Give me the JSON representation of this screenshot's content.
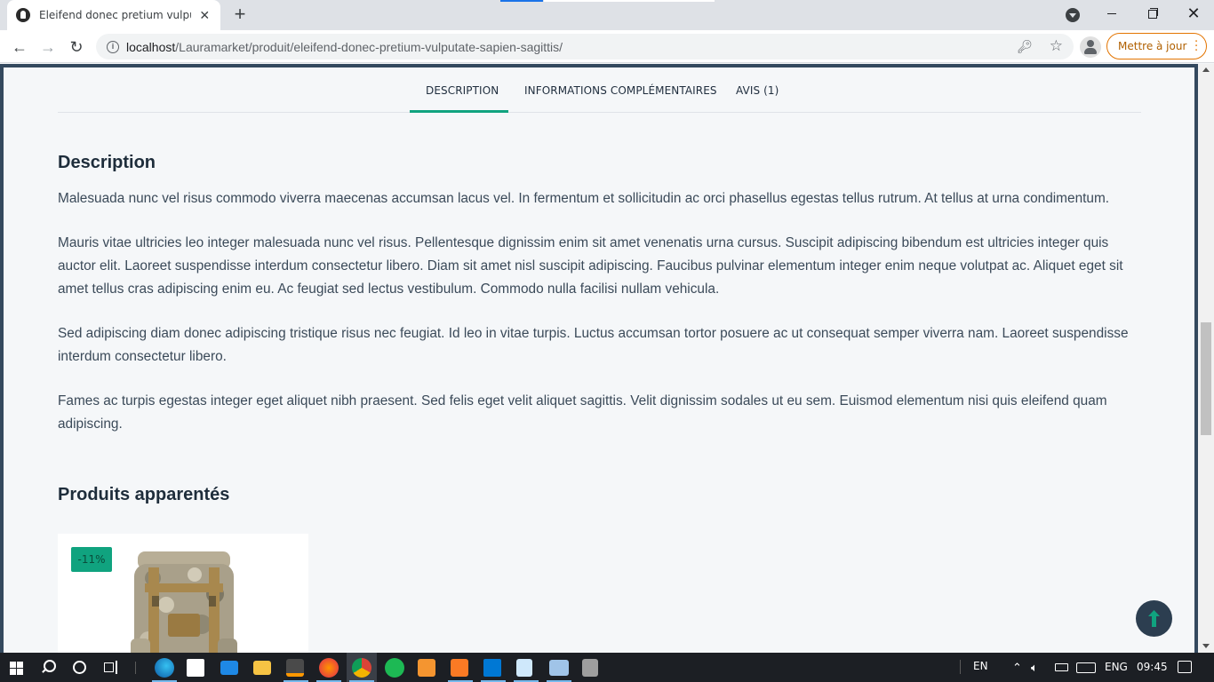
{
  "browser": {
    "tab_title": "Eleifend donec pretium vulputate sapien sagittis – Lauramarket",
    "new_tab_label": "+",
    "close_tab_label": "✕",
    "url_host": "localhost",
    "url_path": "/Lauramarket/produit/eleifend-donec-pretium-vulputate-sapien-sagittis/",
    "update_button_label": "Mettre à jour",
    "window_close_label": "✕"
  },
  "page": {
    "tabs": [
      {
        "label": "DESCRIPTION",
        "active": true
      },
      {
        "label": "INFORMATIONS COMPLÉMENTAIRES",
        "active": false
      },
      {
        "label": "AVIS (1)",
        "active": false
      }
    ],
    "description_heading": "Description",
    "paragraphs": [
      "Malesuada nunc vel risus commodo viverra maecenas accumsan lacus vel. In fermentum et sollicitudin ac orci phasellus egestas tellus rutrum. At tellus at urna condimentum.",
      "Mauris vitae ultricies leo integer malesuada nunc vel risus. Pellentesque dignissim enim sit amet venenatis urna cursus. Suscipit adipiscing bibendum est ultricies integer quis auctor elit. Laoreet suspendisse interdum consectetur libero. Diam sit amet nisl suscipit adipiscing. Faucibus pulvinar elementum integer enim neque volutpat ac. Aliquet eget sit amet tellus cras adipiscing enim eu. Ac feugiat sed lectus vestibulum. Commodo nulla facilisi nullam vehicula.",
      "Sed adipiscing diam donec adipiscing tristique risus nec feugiat. Id leo in vitae turpis. Luctus accumsan tortor posuere ac ut consequat semper viverra nam. Laoreet suspendisse interdum consectetur libero.",
      "Fames ac turpis egestas integer eget aliquet nibh praesent. Sed felis eget velit aliquet sagittis. Velit dignissim sodales ut eu sem. Euismod elementum nisi quis eleifend quam adipiscing."
    ],
    "related_heading": "Produits apparentés",
    "related_products": [
      {
        "badge": "-11%",
        "image": "camouflage-backpack"
      }
    ],
    "accent_color": "#10a37f"
  },
  "taskbar": {
    "lang_short": "EN",
    "lang": "ENG",
    "time": "09:45",
    "apps": [
      "edge",
      "store",
      "mail",
      "file-explorer",
      "sublime-text",
      "firefox",
      "chrome",
      "spotify",
      "git",
      "xampp",
      "vscode",
      "notepad",
      "terminal",
      "calculator"
    ]
  }
}
